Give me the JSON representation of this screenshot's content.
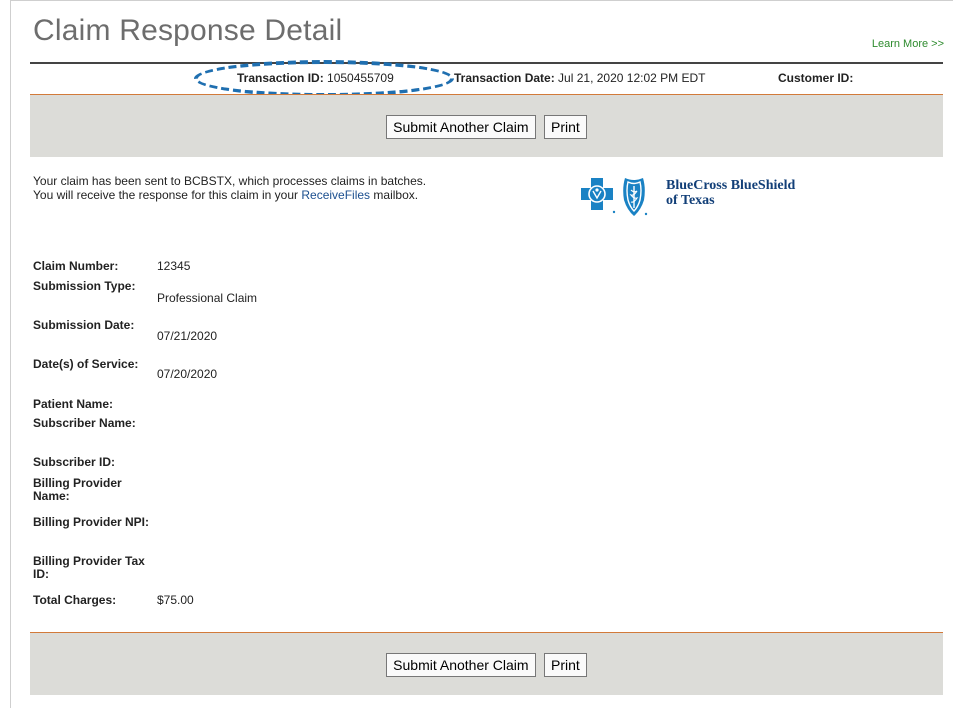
{
  "header": {
    "title": "Claim Response Detail",
    "learn_more": "Learn More >>"
  },
  "transaction": {
    "id_label": "Transaction ID:",
    "id_value": "1050455709",
    "date_label": "Transaction Date:",
    "date_value": "Jul 21, 2020 12:02 PM EDT",
    "customer_label": "Customer ID:",
    "customer_value": ""
  },
  "buttons": {
    "submit_another": "Submit Another Claim",
    "print": "Print"
  },
  "message": {
    "line1_pre": "Your claim has been sent to ",
    "payer": "BCBSTX",
    "line1_post": ", which processes claims in batches.",
    "line2_pre": "You will receive the response for this claim in your ",
    "link": "ReceiveFiles",
    "line2_post": " mailbox."
  },
  "logo": {
    "line1": "BlueCross BlueShield",
    "line2": "of Texas",
    "color": "#1a82c4"
  },
  "details": [
    {
      "label": "Claim Number:",
      "value": "12345"
    },
    {
      "label": "Submission Type:",
      "value": "Professional Claim"
    },
    {
      "label": "Submission Date:",
      "value": "07/21/2020"
    },
    {
      "label": "Date(s) of Service:",
      "value": "07/20/2020"
    },
    {
      "label": "Patient Name:",
      "value": ""
    },
    {
      "label": "Subscriber Name:",
      "value": ""
    },
    {
      "label": "Subscriber ID:",
      "value": ""
    },
    {
      "label": "Billing Provider Name:",
      "value": ""
    },
    {
      "label": "Billing Provider NPI:",
      "value": ""
    },
    {
      "label": "Billing Provider Tax ID:",
      "value": ""
    },
    {
      "label": "Total Charges:",
      "value": "$75.00"
    }
  ]
}
